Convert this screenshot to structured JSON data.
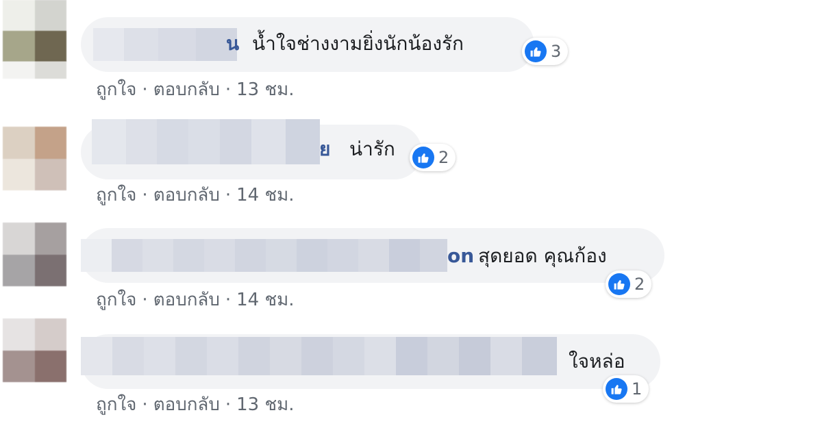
{
  "comments": [
    {
      "name_suffix": "น",
      "text": "น้ำใจช่างงามยิ่งนักน้องรัก",
      "like_count": "3",
      "actions": {
        "like": "ถูกใจ",
        "reply": "ตอบกลับ",
        "time": "13 ชม."
      }
    },
    {
      "name_suffix": "ย",
      "text": "น่ารัก",
      "like_count": "2",
      "actions": {
        "like": "ถูกใจ",
        "reply": "ตอบกลับ",
        "time": "14 ชม."
      }
    },
    {
      "name_suffix": "on",
      "text": "สุดยอด คุณก้อง",
      "like_count": "2",
      "actions": {
        "like": "ถูกใจ",
        "reply": "ตอบกลับ",
        "time": "14 ชม."
      }
    },
    {
      "name_suffix": "",
      "text": "ใจหล่อ",
      "like_count": "1",
      "actions": {
        "like": "ถูกใจ",
        "reply": "ตอบกลับ",
        "time": "13 ชม."
      }
    }
  ],
  "separator": "·",
  "colors": {
    "bubble": "#f2f3f5",
    "like_blue": "#1877f2",
    "name_link": "#385898",
    "meta_gray": "#606770"
  },
  "icons": {
    "reaction": "thumbs-up-icon"
  }
}
